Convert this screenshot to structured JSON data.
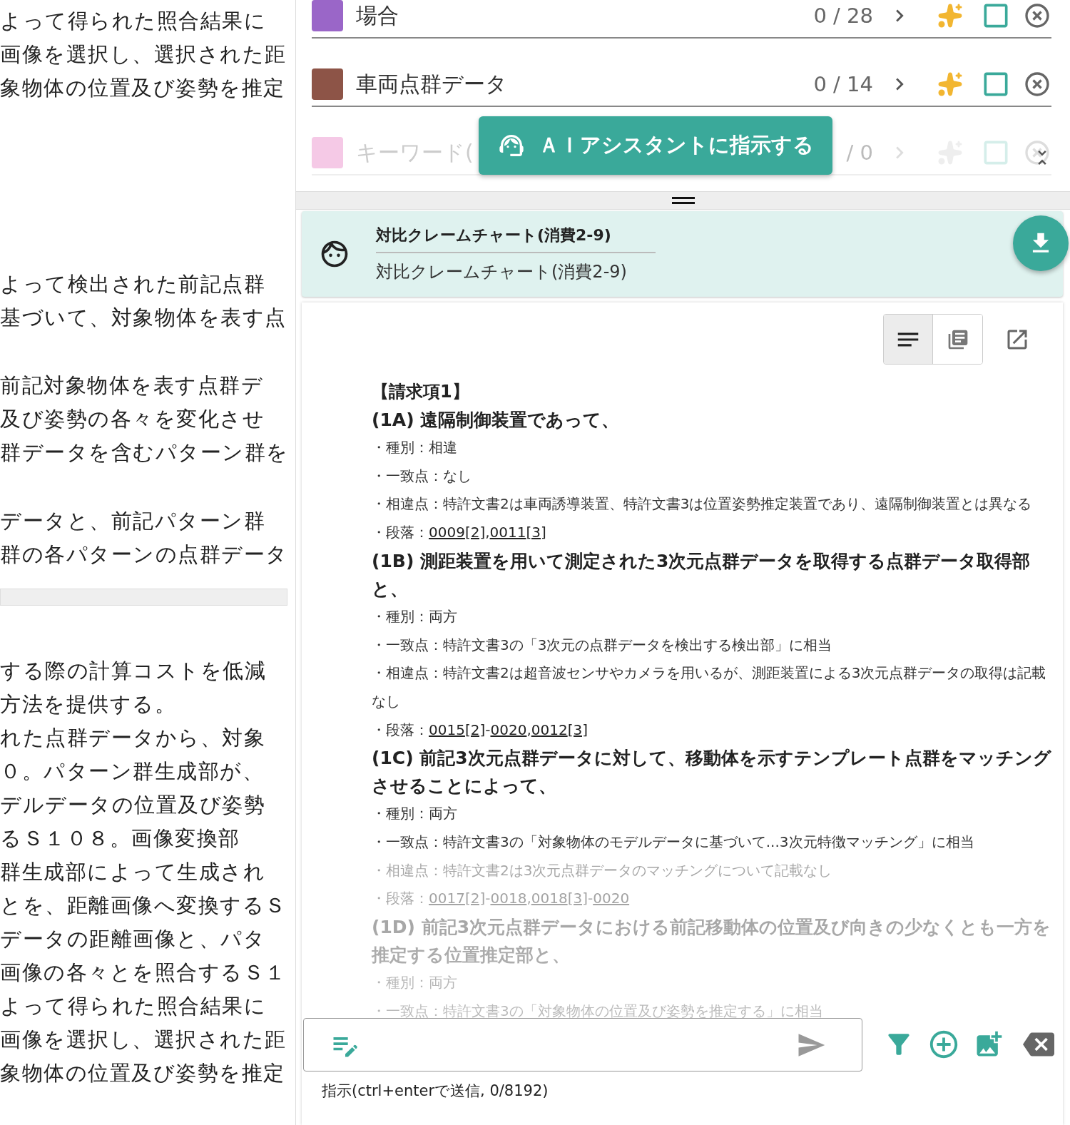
{
  "left_panel": [
    {
      "kind": "text",
      "lines": [
        "よって得られた照合結果に",
        "画像を選択し、選択された距",
        "象物体の位置及び姿勢を推定"
      ]
    },
    {
      "kind": "text",
      "lines": [
        "よって検出された前記点群",
        "基づいて、対象物体を表す点"
      ]
    },
    {
      "kind": "text",
      "lines": [
        "前記対象物体を表す点群デ",
        "及び姿勢の各々を変化させ",
        "群データを含むパターン群を"
      ]
    },
    {
      "kind": "text",
      "lines": [
        "データと、前記パターン群",
        "群の各パターンの点群データ"
      ]
    },
    {
      "kind": "bar"
    },
    {
      "kind": "text",
      "lines": [
        "する際の計算コストを低減",
        "方法を提供する。",
        "れた点群データから、対象",
        "０。パターン群生成部が、",
        "デルデータの位置及び姿勢",
        "るＳ１０８。画像変換部",
        "群生成部によって生成され",
        "とを、距離画像へ変換するＳ",
        "データの距離画像と、パタ",
        "画像の各々とを照合するＳ１",
        "よって得られた照合結果に",
        "画像を選択し、選択された距",
        "象物体の位置及び姿勢を推定"
      ]
    }
  ],
  "keywords": [
    {
      "label": "場合",
      "count": "0 / 28",
      "color": "#9a66c8",
      "checked": false
    },
    {
      "label": "車両点群データ",
      "count": "0 / 14",
      "color": "#8d5447",
      "checked": false
    },
    {
      "label": "キーワード(",
      "count": "/ 0",
      "color": "#f5c9e6",
      "checked": false
    }
  ],
  "ai_button": {
    "label": "ＡＩアシスタントに指示する"
  },
  "chat_card": {
    "title": "対比クレームチャート(消費2-9)",
    "subtitle": "対比クレームチャート(消費2-9)"
  },
  "view_toggle": [
    {
      "kind": "text",
      "selected": true
    },
    {
      "kind": "table",
      "selected": false
    }
  ],
  "claim": {
    "title": "【請求項1】",
    "elements": [
      {
        "heading": "(1A) 遠隔制御装置であって、",
        "lines": [
          "・種別：相違",
          "・一致点：なし",
          "・相違点：特許文書2は車両誘導装置、特許文書3は位置姿勢推定装置であり、遠隔制御装置とは異なる"
        ],
        "refs_label": "・段落：",
        "refs": [
          "0009",
          "[2]",
          ",",
          "0011",
          "[3]"
        ]
      },
      {
        "heading": "(1B) 測距装置を用いて測定された3次元点群データを取得する点群データ取得部と、",
        "lines": [
          "・種別：両方",
          "・一致点：特許文書3の「3次元の点群データを検出する検出部」に相当",
          "・相違点：特許文書2は超音波センサやカメラを用いるが、測距装置による3次元点群データの取得は記載なし"
        ],
        "refs_label": "・段落：",
        "refs": [
          "0015",
          "[2]",
          "-",
          "0020",
          ",",
          "0012",
          "[3]"
        ]
      },
      {
        "heading": "(1C) 前記3次元点群データに対して、移動体を示すテンプレート点群をマッチングさせることによって、",
        "lines": [
          "・種別：両方",
          "・一致点：特許文書3の「対象物体のモデルデータに基づいて...3次元特徴マッチング」に相当",
          "・相違点：特許文書2は3次元点群データのマッチングについて記載なし"
        ],
        "refs_label": "・段落：",
        "refs": [
          "0017",
          "[2]",
          "-",
          "0018",
          ",",
          "0018",
          "[3]",
          "-",
          "0020"
        ]
      },
      {
        "heading": "(1D) 前記3次元点群データにおける前記移動体の位置及び向きの少なくとも一方を推定する位置推定部と、",
        "lines": [
          "・種別：両方",
          "・一致点：特許文書3の「対象物体の位置及び姿勢を推定する」に相当"
        ]
      }
    ]
  },
  "instruction": {
    "hint": "指示(ctrl+enterで送信, 0/8192)"
  }
}
